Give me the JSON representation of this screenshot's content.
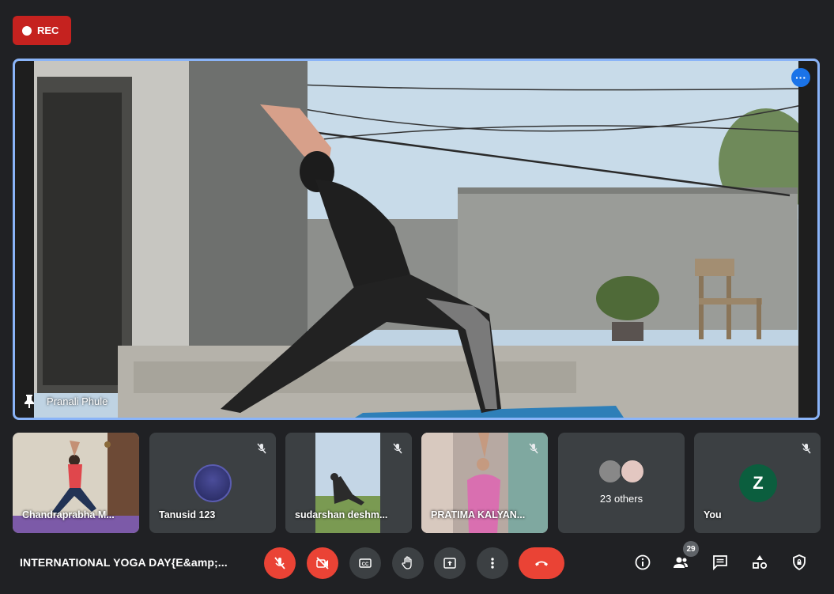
{
  "recording": {
    "label": "REC"
  },
  "main_speaker": {
    "name": "Pranali Phule"
  },
  "participants": [
    {
      "name": "Chandraprabha M...",
      "muted": false,
      "type": "video"
    },
    {
      "name": "Tanusid 123",
      "muted": true,
      "type": "avatar"
    },
    {
      "name": "sudarshan deshm...",
      "muted": true,
      "type": "video"
    },
    {
      "name": "PRATIMA KALYAN...",
      "muted": true,
      "type": "video"
    },
    {
      "name": "23 others",
      "muted": true,
      "type": "group"
    },
    {
      "name": "You",
      "muted": true,
      "type": "avatar",
      "initial": "Z"
    }
  ],
  "meeting": {
    "title": "INTERNATIONAL YOGA DAY{E&amp;..."
  },
  "controls": {
    "participant_count": "29",
    "buttons": [
      "mic-off",
      "camera-off",
      "captions",
      "raise-hand",
      "present",
      "more-options",
      "leave-call"
    ],
    "side_buttons": [
      "meeting-info",
      "people",
      "chat",
      "activities",
      "host-controls"
    ]
  },
  "colors": {
    "accent": "#8ab4f8",
    "danger": "#ea4335",
    "background": "#202124",
    "tile": "#3c4043",
    "avatar_you": "#0b5e3e"
  }
}
